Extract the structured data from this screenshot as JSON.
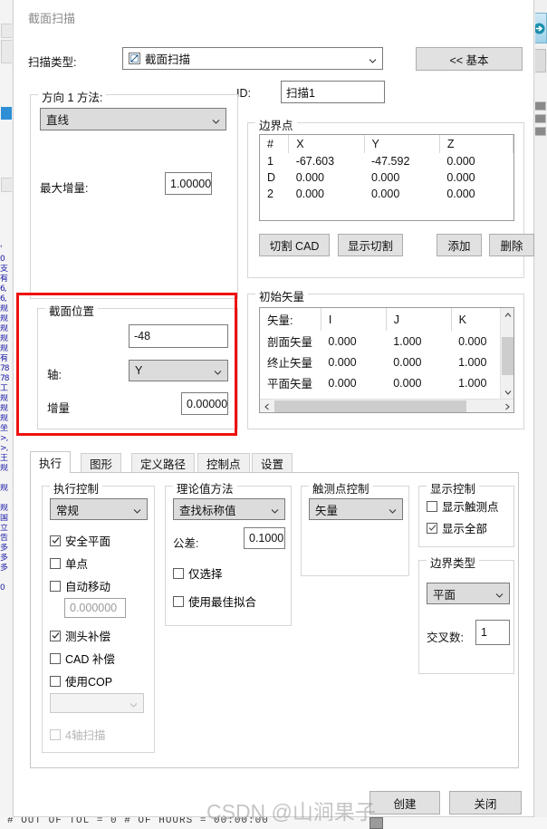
{
  "dialog": {
    "title": "截面扫描"
  },
  "top": {
    "scan_type_label": "扫描类型:",
    "scan_type_value": "截面扫描",
    "scan_type_icon": "section-scan-icon",
    "basic_button": "<<  基本",
    "id_label": "ID:",
    "id_value": "扫描1"
  },
  "direction": {
    "group_title": "方向 1 方法:",
    "method_value": "直线",
    "max_increment_label": "最大增量:",
    "max_increment_value": "1.00000"
  },
  "boundary_points": {
    "group_title": "边界点",
    "columns": [
      "#",
      "X",
      "Y",
      "Z"
    ],
    "rows": [
      [
        "1",
        "-67.603",
        "-47.592",
        "0.000"
      ],
      [
        "D",
        "0.000",
        "0.000",
        "0.000"
      ],
      [
        "2",
        "0.000",
        "0.000",
        "0.000"
      ]
    ],
    "buttons": [
      "切割 CAD",
      "显示切割",
      "添加",
      "删除"
    ]
  },
  "section_position": {
    "group_title": "截面位置",
    "position_value": "-48",
    "axis_label": "轴:",
    "axis_value": "Y",
    "increment_label": "增量",
    "increment_value": "0.00000"
  },
  "initial_vector": {
    "group_title": "初始矢量",
    "columns": [
      "矢量:",
      "I",
      "J",
      "K"
    ],
    "rows": [
      [
        "剖面矢量",
        "0.000",
        "1.000",
        "0.000"
      ],
      [
        "终止矢量",
        "0.000",
        "0.000",
        "1.000"
      ],
      [
        "平面矢量",
        "0.000",
        "0.000",
        "1.000"
      ]
    ]
  },
  "tabs": [
    {
      "label": "执行",
      "active": true
    },
    {
      "label": "图形",
      "active": false
    },
    {
      "label": "定义路径",
      "active": false
    },
    {
      "label": "控制点",
      "active": false
    },
    {
      "label": "设置",
      "active": false
    }
  ],
  "exec_control": {
    "group_title": "执行控制",
    "mode_value": "常规",
    "checkboxes": [
      {
        "label": "安全平面",
        "checked": true,
        "disabled": false
      },
      {
        "label": "单点",
        "checked": false,
        "disabled": false
      },
      {
        "label": "自动移动",
        "checked": false,
        "disabled": false
      }
    ],
    "auto_move_value": "0.000000",
    "checkboxes2": [
      {
        "label": "测头补偿",
        "checked": true,
        "disabled": false
      },
      {
        "label": "CAD 补偿",
        "checked": false,
        "disabled": false
      },
      {
        "label": "使用COP",
        "checked": false,
        "disabled": false
      }
    ],
    "cop_combo_value": "",
    "four_axis": {
      "label": "4轴扫描",
      "checked": false,
      "disabled": true
    }
  },
  "theoretical": {
    "group_title": "理论值方法",
    "method_value": "查找标称值",
    "tolerance_label": "公差:",
    "tolerance_value": "0.1000",
    "checkboxes": [
      {
        "label": "仅选择",
        "checked": false
      },
      {
        "label": "使用最佳拟合",
        "checked": false
      }
    ]
  },
  "touch_control": {
    "group_title": "触测点控制",
    "value": "矢量"
  },
  "display_control": {
    "group_title": "显示控制",
    "checkboxes": [
      {
        "label": "显示触测点",
        "checked": false
      },
      {
        "label": "显示全部",
        "checked": true
      }
    ]
  },
  "boundary_type": {
    "group_title": "边界类型",
    "value": "平面",
    "cross_label": "交叉数:",
    "cross_value": "1"
  },
  "footer": {
    "create_button": "创建",
    "close_button": "关闭"
  },
  "watermark": {
    "text": "CSDN @山涧果子"
  },
  "statusbar": {
    "text": "# OUT OF TOL = 0    # OF HOURS = 00:00:00"
  },
  "bg_strip": {
    "glyph_lines": [
      "'",
      "0",
      "支",
      "有",
      "6,",
      "6,",
      "规",
      "规",
      "规",
      "规",
      "规",
      "有",
      "78",
      "78",
      "工",
      "规",
      "规",
      "规",
      "坐",
      ">,",
      ">,",
      "王",
      "规",
      "",
      "规",
      "",
      "规",
      "国",
      "立",
      "告",
      "多",
      "多",
      "多",
      "",
      "0"
    ]
  },
  "colors": {
    "accent_red": "#ee1111",
    "window_bg": "#ffffff",
    "control_bg": "#dcdcdc",
    "button_bg": "#e1e1e1"
  }
}
